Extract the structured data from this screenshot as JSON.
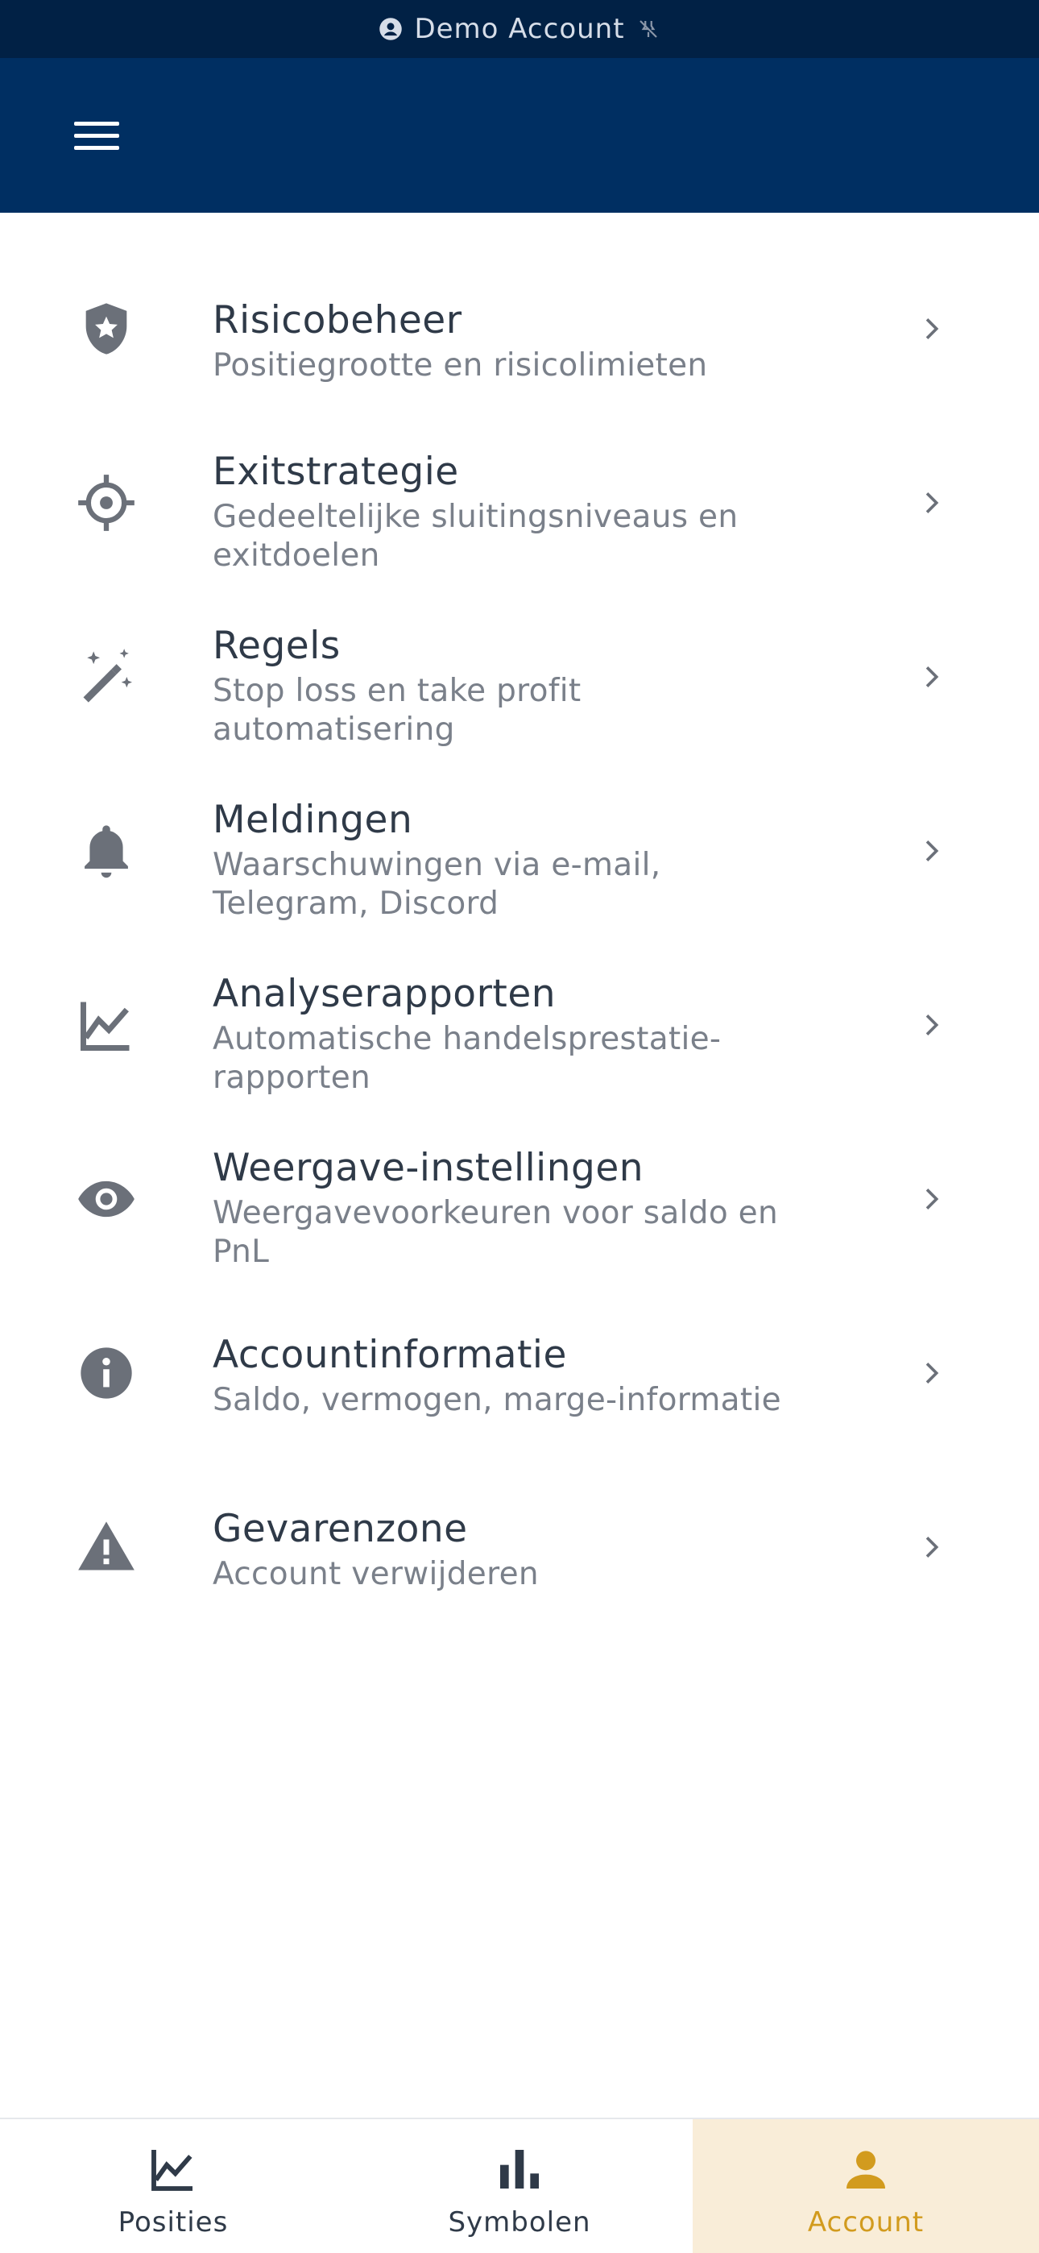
{
  "banner": {
    "text": "Demo Account",
    "icon": "account-circle-icon",
    "status_icon": "link-off-icon"
  },
  "header": {
    "menu_icon": "hamburger-menu-icon"
  },
  "settings": [
    {
      "title": "Risicobeheer",
      "subtitle": "Positiegrootte en risicolimieten",
      "icon": "shield-star-icon"
    },
    {
      "title": "Exitstrategie",
      "subtitle": "Gedeeltelijke sluitingsniveaus en exitdoelen",
      "icon": "crosshair-icon"
    },
    {
      "title": "Regels",
      "subtitle": "Stop loss en take profit automatisering",
      "icon": "magic-wand-icon"
    },
    {
      "title": "Meldingen",
      "subtitle": "Waarschuwingen via e-mail, Telegram, Discord",
      "icon": "bell-icon"
    },
    {
      "title": "Analyserapporten",
      "subtitle": "Automatische handelsprestatie-rapporten",
      "icon": "line-chart-icon"
    },
    {
      "title": "Weergave-instellingen",
      "subtitle": "Weergavevoorkeuren voor saldo en PnL",
      "icon": "eye-icon"
    },
    {
      "title": "Accountinformatie",
      "subtitle": "Saldo, vermogen, marge-informatie",
      "icon": "info-icon"
    },
    {
      "title": "Gevarenzone",
      "subtitle": "Account verwijderen",
      "icon": "warning-icon"
    }
  ],
  "bottom_nav": [
    {
      "label": "Posities",
      "icon": "line-chart-icon",
      "active": false
    },
    {
      "label": "Symbolen",
      "icon": "bar-chart-icon",
      "active": false
    },
    {
      "label": "Account",
      "icon": "person-icon",
      "active": true
    }
  ],
  "colors": {
    "banner_bg": "#012145",
    "header_bg": "#002f62",
    "icon_gray": "#6b7079",
    "active_accent": "#d29b1e",
    "active_bg": "#f9edd8"
  }
}
